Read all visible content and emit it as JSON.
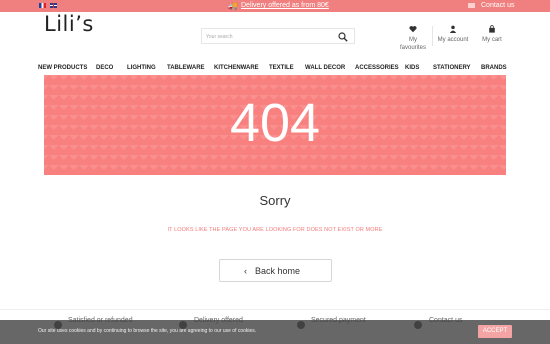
{
  "topbar": {
    "delivery_text": "Delivery offered as from 80€",
    "contact_text": "Contact us",
    "languages": [
      "fr",
      "en"
    ],
    "color": "#f08080"
  },
  "header": {
    "logo": "Lili’s",
    "search_placeholder": "Your search",
    "favourites_label": "My favourites",
    "account_label": "My account",
    "cart_label": "My cart"
  },
  "nav": {
    "items": [
      "NEW PRODUCTS",
      "DECO",
      "LIGHTING",
      "TABLEWARE",
      "KITCHENWARE",
      "TEXTILE",
      "WALL DECOR",
      "ACCESSORIES",
      "KIDS",
      "STATIONERY",
      "BRANDS"
    ]
  },
  "error": {
    "code": "404",
    "title": "Sorry",
    "message": "IT LOOKS LIKE THE PAGE YOU ARE LOOKING FOR DOES NOT EXIST OR MORE",
    "back_label": "Back home",
    "accent": "#f8807e"
  },
  "footer": {
    "items": [
      {
        "title": "Satisfied or refunded",
        "sub": ""
      },
      {
        "title": "Delivery offered",
        "sub": ""
      },
      {
        "title": "Secured payment",
        "sub": ""
      },
      {
        "title": "Contact us",
        "sub": ""
      }
    ]
  },
  "cookie": {
    "text": "Our site uses cookies and by continuing to browse the site, you are agreeing to our use of cookies.",
    "accept_label": "ACCEPT"
  }
}
